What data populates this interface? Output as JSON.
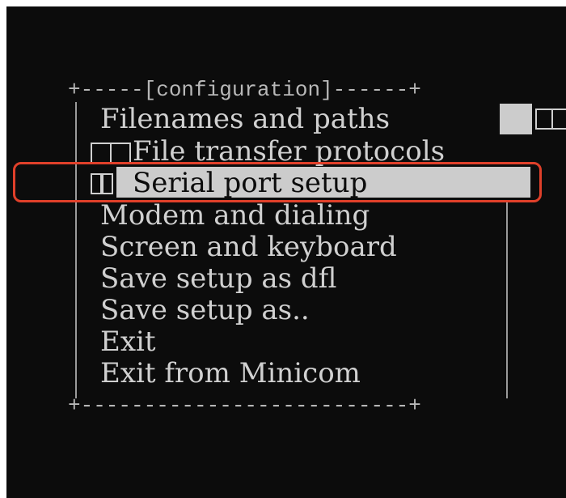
{
  "menu": {
    "title_line": "+-----[configuration]------+",
    "bottom_line": "+--------------------------+",
    "items": [
      {
        "label": "Filenames and paths"
      },
      {
        "label": "File transfer protocols"
      },
      {
        "label": "Serial port setup",
        "selected": true
      },
      {
        "label": "Modem and dialing"
      },
      {
        "label": "Screen and keyboard"
      },
      {
        "label": "Save setup as dfl"
      },
      {
        "label": "Save setup as.."
      },
      {
        "label": "Exit"
      },
      {
        "label": "Exit from Minicom"
      }
    ]
  },
  "colors": {
    "background": "#0c0c0c",
    "text": "#d0d0d0",
    "highlight": "#cccccc",
    "annotation": "#e0402a"
  }
}
